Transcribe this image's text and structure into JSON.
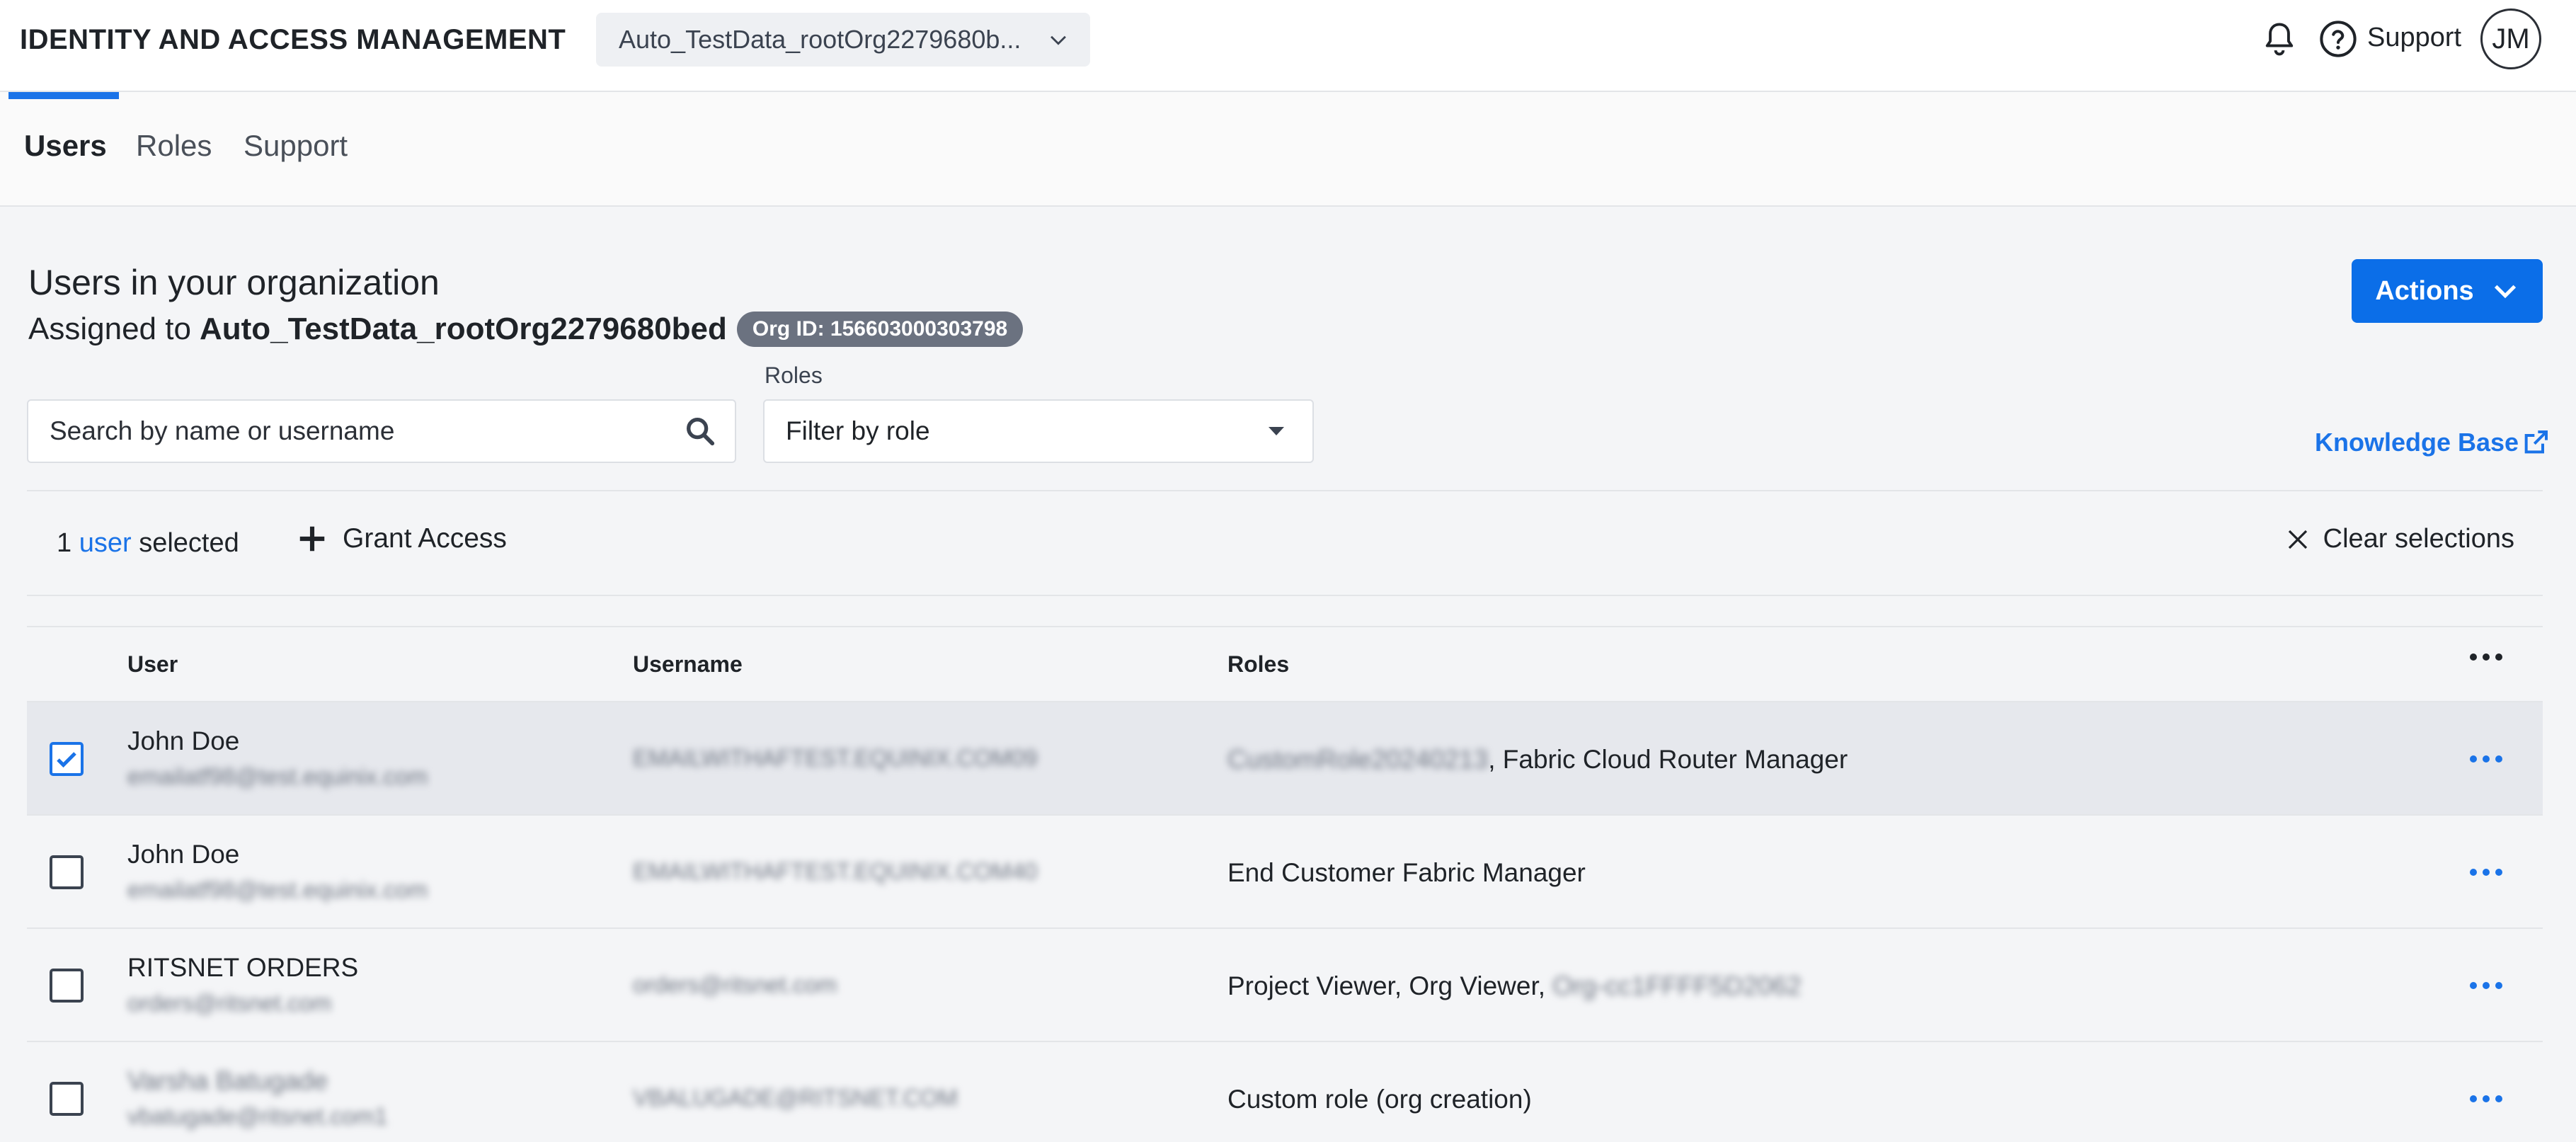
{
  "header": {
    "app_title": "IDENTITY AND ACCESS MANAGEMENT",
    "org_switcher": "Auto_TestData_rootOrg2279680b...",
    "support_label": "Support",
    "avatar_initials": "JM"
  },
  "tabs": [
    {
      "label": "Users",
      "active": true
    },
    {
      "label": "Roles",
      "active": false
    },
    {
      "label": "Support",
      "active": false
    }
  ],
  "section": {
    "title": "Users in your organization",
    "assigned_prefix": "Assigned to",
    "org_name": "Auto_TestData_rootOrg2279680bed",
    "org_id_badge": "Org ID: 156603000303798",
    "actions_label": "Actions"
  },
  "filters": {
    "search_placeholder": "Search by name or username",
    "roles_label": "Roles",
    "role_placeholder": "Filter by role",
    "knowledge_base": "Knowledge Base"
  },
  "selection": {
    "count": "1",
    "noun": "user",
    "suffix": "selected",
    "grant_access": "Grant Access",
    "clear": "Clear selections"
  },
  "table": {
    "columns": [
      "User",
      "Username",
      "Roles"
    ],
    "rows": [
      {
        "name": "John Doe",
        "email": "emailatf98@test.equinix.com",
        "username": "EMAILWITHAFTEST.EQUINIX.COM09",
        "roles_hidden": "CustomRole20240213",
        "roles": ", Fabric Cloud Router Manager",
        "selected": true
      },
      {
        "name": "John Doe",
        "email": "emailatf98@test.equinix.com",
        "username": "EMAILWITHAFTEST.EQUINIX.COM40",
        "roles_hidden": "",
        "roles": "End Customer Fabric Manager",
        "selected": false
      },
      {
        "name": "RITSNET ORDERS",
        "email": "orders@ritsnet.com",
        "username": "orders@ritsnet.com",
        "roles_hidden": "",
        "roles": "Project Viewer, Org Viewer, ",
        "roles_hidden_after": "Org-cc1FFFF5D2062",
        "selected": false
      },
      {
        "name": "Varsha Batugade",
        "email": "vbatugade@ritsnet.com1",
        "username": "VBALUGADE@RITSNET.COM",
        "roles_hidden": "",
        "roles": "Custom role (org creation)",
        "selected": false
      }
    ]
  },
  "colors": {
    "accent": "#1a73e8",
    "primary_button": "#0b6ee8",
    "badge": "#6b7280",
    "selected_row": "#e6e8ed"
  }
}
